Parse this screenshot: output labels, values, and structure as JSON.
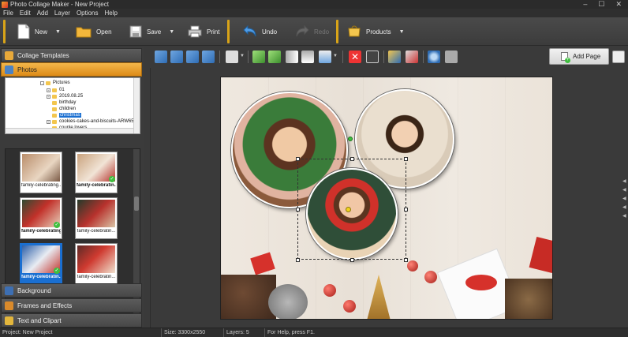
{
  "window": {
    "title": "Photo Collage Maker - New Project",
    "controls": [
      "–",
      "☐",
      "✕"
    ]
  },
  "menu": [
    "File",
    "Edit",
    "Add",
    "Layer",
    "Options",
    "Help"
  ],
  "toolbar": {
    "new": "New",
    "open": "Open",
    "save": "Save",
    "print": "Print",
    "undo": "Undo",
    "redo": "Redo",
    "products": "Products"
  },
  "left_panel": {
    "collage_templates": "Collage Templates",
    "photos": "Photos",
    "background": "Background",
    "frames_effects": "Frames and Effects",
    "text_clipart": "Text and Clipart",
    "tree": [
      {
        "label": "Pictures",
        "expander": "-"
      },
      {
        "label": "01",
        "expander": "+"
      },
      {
        "label": "2019.08.25",
        "expander": "+"
      },
      {
        "label": "birthday",
        "expander": ""
      },
      {
        "label": "children",
        "expander": ""
      },
      {
        "label": "christmas",
        "expander": "",
        "selected": true
      },
      {
        "label": "cookies-cakes-and-biscuits-ARW65",
        "expander": "+"
      },
      {
        "label": "couple lovers",
        "expander": ""
      }
    ],
    "thumbnails": [
      {
        "caption": "family-celebrating...",
        "selected": false,
        "used": false
      },
      {
        "caption": "family-celebratin...",
        "selected": false,
        "used": true
      },
      {
        "caption": "family-celebrating...",
        "selected": false,
        "used": true
      },
      {
        "caption": "family-celebratin...",
        "selected": false,
        "used": false
      },
      {
        "caption": "family-celebratin...",
        "selected": true,
        "used": true
      },
      {
        "caption": "family-celebratin...",
        "selected": false,
        "used": false
      }
    ]
  },
  "edit_bar": {
    "add_page": "Add Page"
  },
  "status": {
    "project": "Project: New Project",
    "size": "Size: 3300x2550",
    "layers": "Layers: 5",
    "help": "For Help, press F1."
  },
  "colors": {
    "accent": "#e69b22",
    "selection": "#1a6fd1",
    "panel": "#3a3a3a"
  }
}
